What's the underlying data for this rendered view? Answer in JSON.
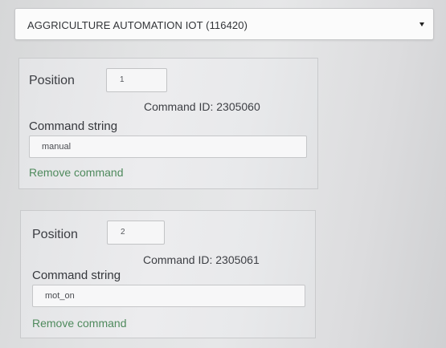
{
  "device_select": {
    "selected": "AGGRICULTURE AUTOMATION IOT (116420)"
  },
  "commands": [
    {
      "position_label": "Position",
      "position_value": "1",
      "command_id_text": "Command ID: 2305060",
      "command_string_label": "Command string",
      "command_string_value": "manual",
      "remove_label": "Remove command"
    },
    {
      "position_label": "Position",
      "position_value": "2",
      "command_id_text": "Command ID: 2305061",
      "command_string_label": "Command string",
      "command_string_value": "mot_on",
      "remove_label": "Remove command"
    }
  ],
  "icons": {
    "select_caret": "caret-down-icon"
  }
}
